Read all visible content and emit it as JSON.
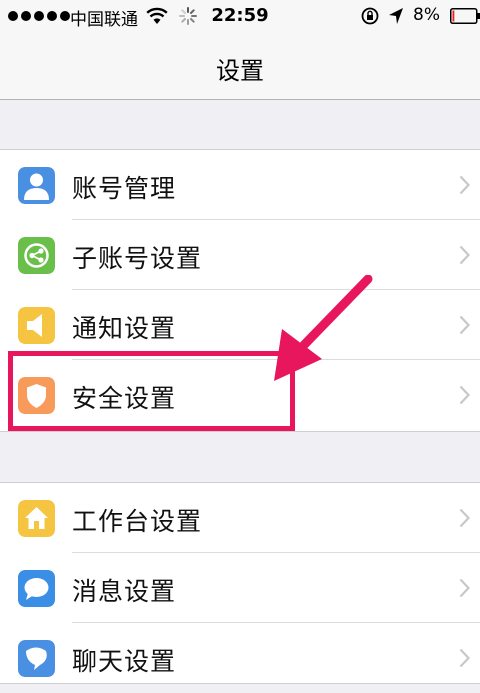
{
  "status_bar": {
    "carrier": "中国联通",
    "time": "22:59",
    "battery_percent": "8%",
    "battery_level": 0.08,
    "battery_color": "#e8202a"
  },
  "nav": {
    "title": "设置"
  },
  "groups": [
    {
      "items": [
        {
          "label": "账号管理",
          "icon": "person-icon",
          "color": "#4a90e2"
        },
        {
          "label": "子账号设置",
          "icon": "share-circle-icon",
          "color": "#6abf4b"
        },
        {
          "label": "通知设置",
          "icon": "speaker-icon",
          "color": "#f5c542"
        },
        {
          "label": "安全设置",
          "icon": "shield-icon",
          "color": "#f79a5a"
        }
      ]
    },
    {
      "items": [
        {
          "label": "工作台设置",
          "icon": "home-icon",
          "color": "#f5c542"
        },
        {
          "label": "消息设置",
          "icon": "chat-bubble-icon",
          "color": "#3a8ee6"
        },
        {
          "label": "聊天设置",
          "icon": "chat-icon",
          "color": "#4a90e2"
        }
      ]
    }
  ],
  "annotation": {
    "highlight_color": "#e8175d"
  }
}
